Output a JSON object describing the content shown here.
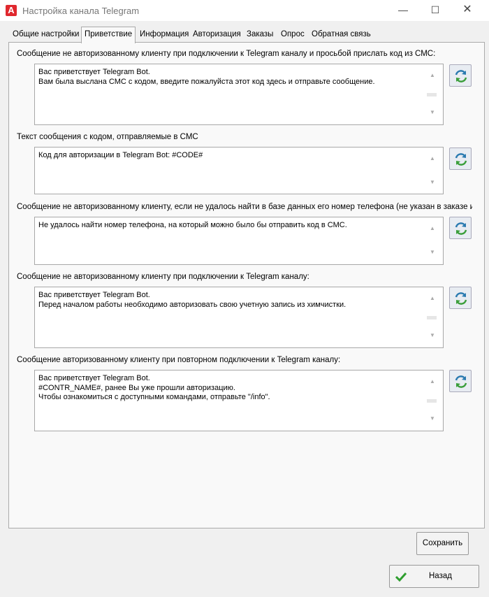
{
  "window": {
    "title": "Настройка канала Telegram",
    "app_icon_letter": "A",
    "minimize_glyph": "—",
    "maximize_glyph": "☐",
    "close_glyph": "✕"
  },
  "tabs": [
    {
      "label": "Общие настройки",
      "active": false
    },
    {
      "label": "Приветствие",
      "active": true
    },
    {
      "label": "Информация",
      "active": false
    },
    {
      "label": "Авторизация",
      "active": false
    },
    {
      "label": "Заказы",
      "active": false
    },
    {
      "label": "Опрос",
      "active": false
    },
    {
      "label": "Обратная связь",
      "active": false
    }
  ],
  "fields": [
    {
      "label": "Сообщение не авторизованному клиенту при подключении к Telegram каналу и просьбой прислать код из СМС:",
      "value": "Вас приветствует Telegram Bot.\nВам была выслана СМС с кодом, введите пожалуйста этот код здесь и отправьте сообщение."
    },
    {
      "label": "Текст сообщения с кодом, отправляемые в СМС",
      "value": "Код для авторизации в Telegram Bot: #CODE#"
    },
    {
      "label": "Сообщение не авторизованному клиенту, если не удалось найти в базе данных его номер телефона (не указан в заказе и не у",
      "value": "Не удалось найти номер телефона, на который можно было бы отправить код в СМС."
    },
    {
      "label": "Сообщение не авторизованному клиенту при подключении к Telegram каналу:",
      "value": "Вас приветствует Telegram Bot.\nПеред началом работы необходимо авторизовать свою учетную запись из химчистки."
    },
    {
      "label": "Сообщение авторизованному клиенту при повторном подключении к Telegram каналу:",
      "value": "Вас приветствует Telegram Bot.\n #CONTR_NAME#, ранее Вы уже прошли авторизацию.\nЧтобы ознакомиться с доступными командами, отправьте \"/info\"."
    }
  ],
  "buttons": {
    "save": "Сохранить",
    "back": "Назад"
  },
  "icons": {
    "reset": "refresh-default-icon",
    "back": "green-check-icon"
  },
  "colors": {
    "app_icon": "#e0282e",
    "check": "#2e9e2e"
  }
}
